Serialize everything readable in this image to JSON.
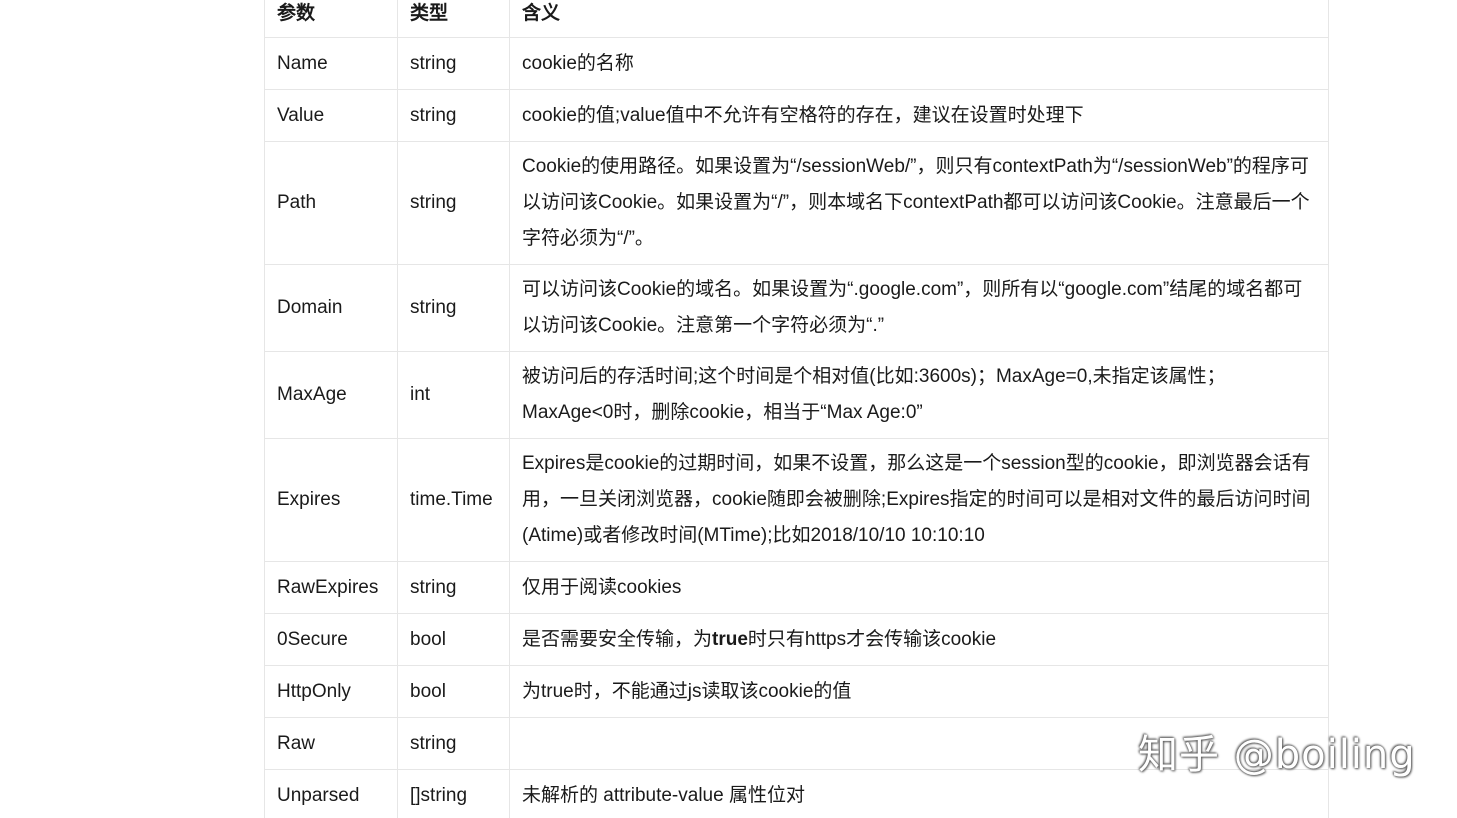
{
  "table": {
    "headers": [
      "参数",
      "类型",
      "含义"
    ],
    "rows": [
      {
        "param": "Name",
        "type": "string",
        "meaning": "cookie的名称"
      },
      {
        "param": "Value",
        "type": "string",
        "meaning": "cookie的值;value值中不允许有空格符的存在，建议在设置时处理下"
      },
      {
        "param": "Path",
        "type": "string",
        "meaning": "Cookie的使用路径。如果设置为“/sessionWeb/”，则只有contextPath为“/sessionWeb”的程序可以访问该Cookie。如果设置为“/”，则本域名下contextPath都可以访问该Cookie。注意最后一个字符必须为“/”。"
      },
      {
        "param": "Domain",
        "type": "string",
        "meaning": "可以访问该Cookie的域名。如果设置为“.google.com”，则所有以“google.com”结尾的域名都可以访问该Cookie。注意第一个字符必须为“.”"
      },
      {
        "param": "MaxAge",
        "type": "int",
        "meaning": "被访问后的存活时间;这个时间是个相对值(比如:3600s)；MaxAge=0,未指定该属性；MaxAge<0时，删除cookie，相当于“Max Age:0”"
      },
      {
        "param": "Expires",
        "type": "time.Time",
        "meaning": "Expires是cookie的过期时间，如果不设置，那么这是一个session型的cookie，即浏览器会话有用，一旦关闭浏览器，cookie随即会被删除;Expires指定的时间可以是相对文件的最后访问时间(Atime)或者修改时间(MTime);比如2018/10/10 10:10:10"
      },
      {
        "param": "RawExpires",
        "type": "string",
        "meaning": "仅用于阅读cookies"
      },
      {
        "param": "0Secure",
        "type": "bool",
        "meaning_pre": "是否需要安全传输，为",
        "meaning_bold": "true",
        "meaning_post": "时只有https才会传输该cookie"
      },
      {
        "param": "HttpOnly",
        "type": "bool",
        "meaning": "为true时，不能通过js读取该cookie的值"
      },
      {
        "param": "Raw",
        "type": "string",
        "meaning": ""
      },
      {
        "param": "Unparsed",
        "type": "[]string",
        "meaning": "未解析的 attribute-value 属性位对"
      }
    ]
  },
  "watermark": "知乎 @boiling"
}
